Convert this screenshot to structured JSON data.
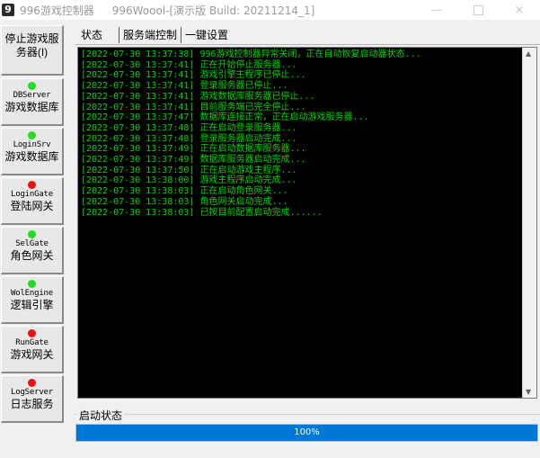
{
  "window": {
    "title": "996游戏控制器",
    "title2": "996Woool-[演示版 Build: 20211214_1]",
    "icon_letter": "9"
  },
  "sidebar": {
    "stop_button": "停止游戏服务器(I)",
    "services": [
      {
        "name": "DBServer",
        "desc": "游戏数据库",
        "status_color": "#22dd22"
      },
      {
        "name": "LoginSrv",
        "desc": "游戏数据库",
        "status_color": "#22dd22"
      },
      {
        "name": "LoginGate",
        "desc": "登陆网关",
        "status_color": "#ee1111"
      },
      {
        "name": "SelGate",
        "desc": "角色网关",
        "status_color": "#22dd22"
      },
      {
        "name": "WolEngine",
        "desc": "逻辑引擎",
        "status_color": "#22dd22"
      },
      {
        "name": "RunGate",
        "desc": "游戏网关",
        "status_color": "#ee1111"
      },
      {
        "name": "LogServer",
        "desc": "日志服务",
        "status_color": "#ee1111"
      }
    ]
  },
  "tabs": [
    {
      "label": "状态"
    },
    {
      "label": "服务端控制"
    },
    {
      "label": "一键设置"
    }
  ],
  "log": [
    "[2022-07-30 13:37:38] 996游戏控制器异常关闭，正在自动恢复启动器状态...",
    "[2022-07-30 13:37:41] 正在开始停止服务器...",
    "[2022-07-30 13:37:41] 游戏引擎主程序已停止...",
    "[2022-07-30 13:37:41] 登录服务器已停止...",
    "[2022-07-30 13:37:41] 游戏数据库服务器已停止...",
    "[2022-07-30 13:37:41] 目前服务端已完全停止...",
    "[2022-07-30 13:37:47] 数据库连接正常，正在启动游戏服务器...",
    "[2022-07-30 13:37:48] 正在启动登录服务器...",
    "[2022-07-30 13:37:48] 登录服务器启动完成...",
    "[2022-07-30 13:37:49] 正在启动数据库服务器...",
    "[2022-07-30 13:37:49] 数据库服务器启动完成...",
    "[2022-07-30 13:37:50] 正在启动游戏主程序...",
    "[2022-07-30 13:38:00] 游戏主程序启动完成...",
    "[2022-07-30 13:38:03] 正在启动角色网关...",
    "[2022-07-30 13:38:03] 角色网关启动完成...",
    "[2022-07-30 13:38:03] 已按目前配置启动完成......"
  ],
  "status": {
    "title": "启动状态",
    "progress_text": "100%",
    "progress_fraction": 1.0
  },
  "colors": {
    "log_text": "#00d800",
    "progress_fill": "#0078d7"
  }
}
